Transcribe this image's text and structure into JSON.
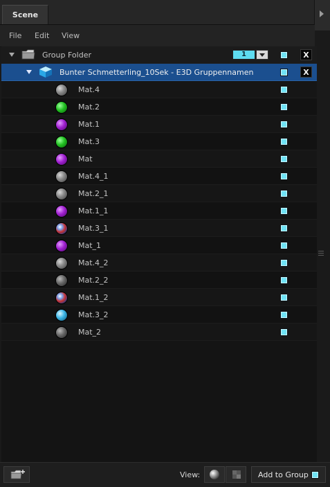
{
  "panel": {
    "tab_title": "Scene"
  },
  "menu": {
    "items": [
      "File",
      "Edit",
      "View"
    ]
  },
  "tree": {
    "folder": {
      "label": "Group Folder",
      "layer_number": "1",
      "visible": true
    },
    "group": {
      "label": "Bunter Schmetterling_10Sek - E3D Gruppennamen",
      "visible": true
    },
    "materials": [
      {
        "label": "Mat.4",
        "icon": "grey-material-sphere-icon"
      },
      {
        "label": "Mat.2",
        "icon": "green-material-sphere-icon"
      },
      {
        "label": "Mat.1",
        "icon": "purple-material-sphere-icon"
      },
      {
        "label": "Mat.3",
        "icon": "green-material-sphere-icon"
      },
      {
        "label": "Mat",
        "icon": "purple-material-sphere-icon"
      },
      {
        "label": "Mat.4_1",
        "icon": "grey-material-sphere-icon"
      },
      {
        "label": "Mat.2_1",
        "icon": "grey-material-sphere-icon"
      },
      {
        "label": "Mat.1_1",
        "icon": "purple-material-sphere-icon"
      },
      {
        "label": "Mat.3_1",
        "icon": "multicolor-material-sphere-icon"
      },
      {
        "label": "Mat_1",
        "icon": "purple-material-sphere-icon"
      },
      {
        "label": "Mat.4_2",
        "icon": "grey-material-sphere-icon"
      },
      {
        "label": "Mat.2_2",
        "icon": "dark-material-sphere-icon"
      },
      {
        "label": "Mat.1_2",
        "icon": "multicolor-material-sphere-icon"
      },
      {
        "label": "Mat.3_2",
        "icon": "blue-material-sphere-icon"
      },
      {
        "label": "Mat_2",
        "icon": "dark-material-sphere-icon"
      }
    ]
  },
  "footer": {
    "view_label": "View:",
    "add_to_group_label": "Add to Group",
    "add_to_group_checked": true
  },
  "colors": {
    "selection": "#1b4f8f",
    "visibility_toggle": "#6fe3f5",
    "background": "#141414"
  }
}
